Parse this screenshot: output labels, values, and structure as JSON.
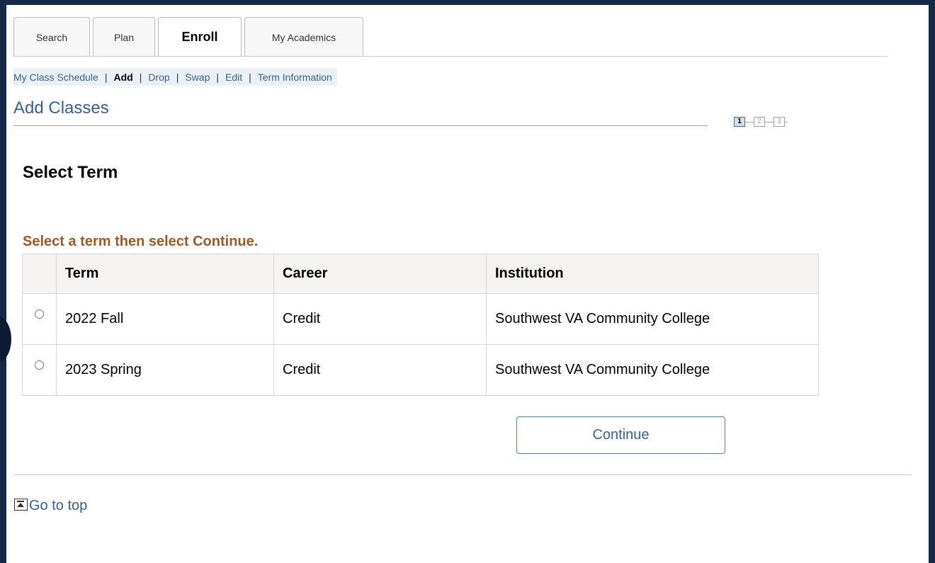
{
  "tabs": [
    {
      "label": "Search",
      "active": false
    },
    {
      "label": "Plan",
      "active": false
    },
    {
      "label": "Enroll",
      "active": true
    },
    {
      "label": "My Academics",
      "active": false
    }
  ],
  "subnav": {
    "items": [
      {
        "label": "My Class Schedule",
        "current": false
      },
      {
        "label": "Add",
        "current": true
      },
      {
        "label": "Drop",
        "current": false
      },
      {
        "label": "Swap",
        "current": false
      },
      {
        "label": "Edit",
        "current": false
      },
      {
        "label": "Term Information",
        "current": false
      }
    ],
    "separator": "|"
  },
  "page": {
    "title": "Add Classes",
    "steps": [
      "1",
      "2",
      "3"
    ],
    "active_step": "1",
    "section_title": "Select Term",
    "instruction": "Select a term then select Continue."
  },
  "table": {
    "headers": [
      "Term",
      "Career",
      "Institution"
    ],
    "rows": [
      {
        "term": "2022 Fall",
        "career": "Credit",
        "institution": "Southwest VA Community College",
        "selected": false
      },
      {
        "term": "2023 Spring",
        "career": "Credit",
        "institution": "Southwest VA Community College",
        "selected": false
      }
    ]
  },
  "actions": {
    "continue_label": "Continue"
  },
  "footer": {
    "go_to_top": "Go to top",
    "icon": "go-to-top-icon"
  },
  "colors": {
    "frame": "#15284a",
    "link": "#3a5f8f",
    "instruction": "#9a5a2a"
  }
}
